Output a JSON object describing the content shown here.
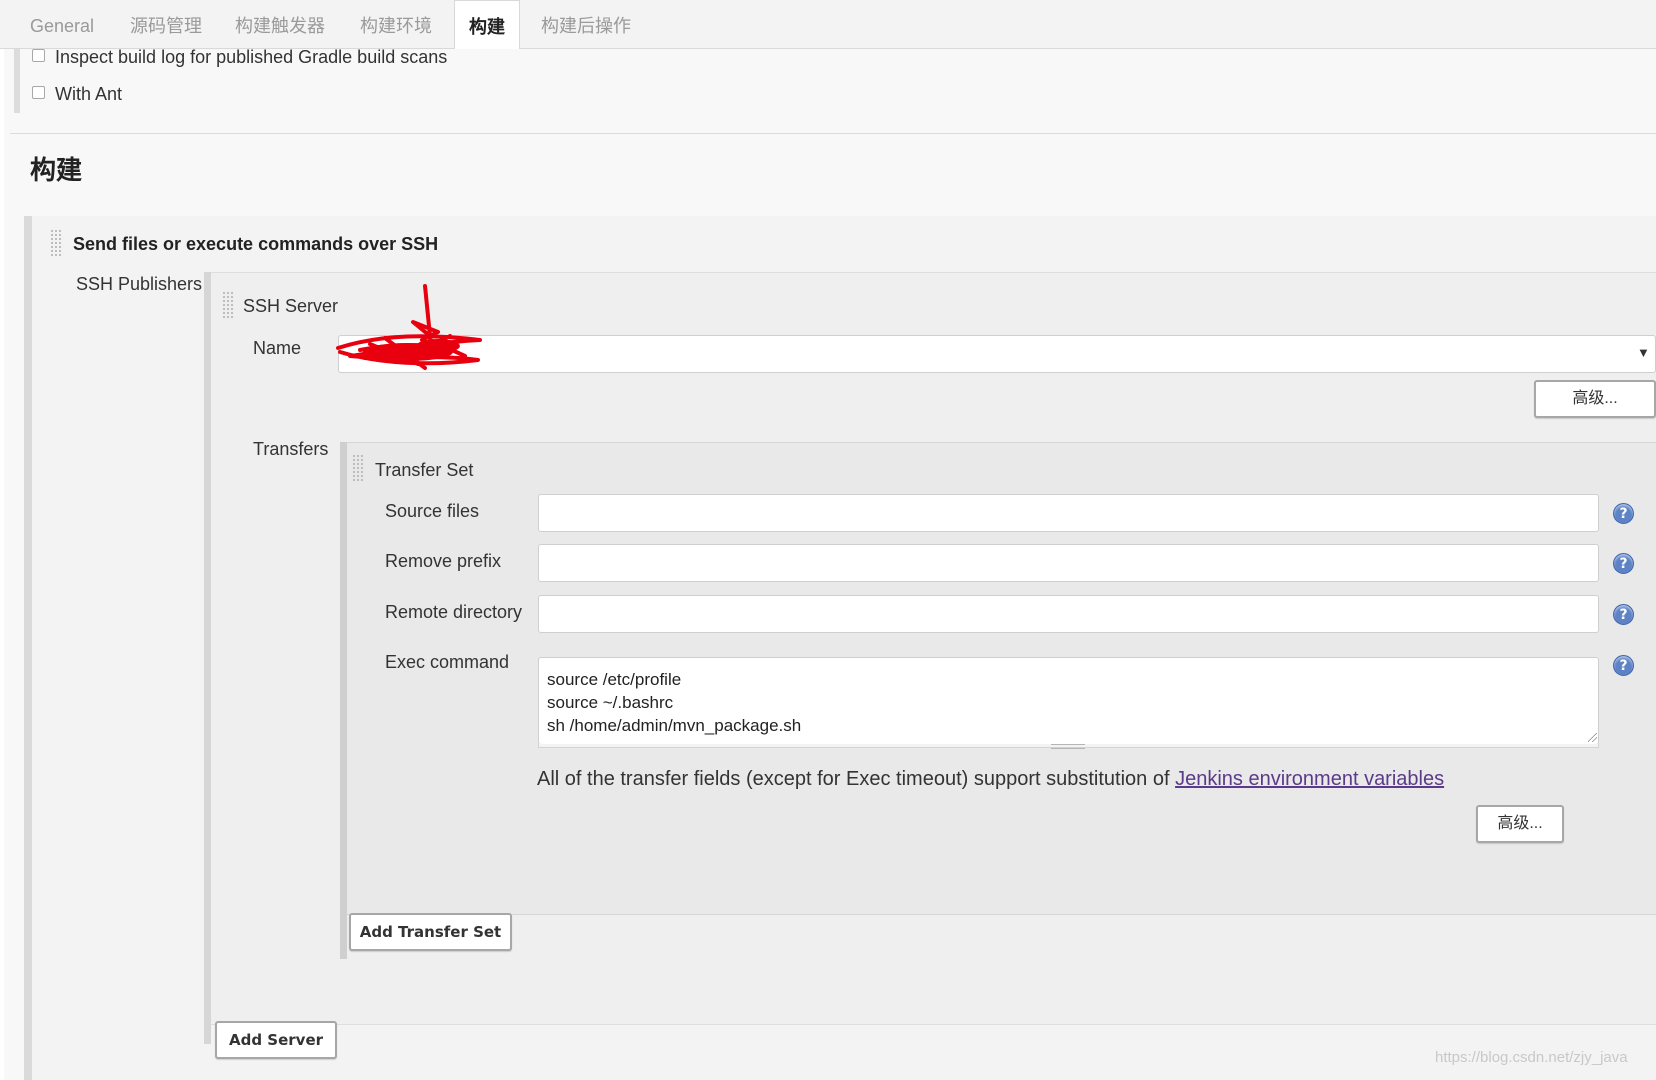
{
  "tabs": [
    {
      "label": "General"
    },
    {
      "label": "源码管理"
    },
    {
      "label": "构建触发器"
    },
    {
      "label": "构建环境"
    },
    {
      "label": "构建"
    },
    {
      "label": "构建后操作"
    }
  ],
  "env_options": [
    {
      "label": "Inspect build log for published Gradle build scans",
      "checked": false
    },
    {
      "label": "With Ant",
      "checked": false
    }
  ],
  "section": {
    "title": "构建"
  },
  "build_step": {
    "title": "Send files or execute commands over SSH",
    "publishers_label": "SSH Publishers",
    "server": {
      "title": "SSH Server",
      "name_label": "Name",
      "name_value": "",
      "advanced_label": "高级..."
    },
    "transfers_label": "Transfers",
    "transfer_set": {
      "title": "Transfer Set",
      "source_files_label": "Source files",
      "source_files_value": "",
      "remove_prefix_label": "Remove prefix",
      "remove_prefix_value": "",
      "remote_directory_label": "Remote directory",
      "remote_directory_value": "",
      "exec_command_label": "Exec command",
      "exec_command_lines": [
        "source /etc/profile",
        "source ~/.bashrc",
        "sh /home/admin/mvn_package.sh"
      ],
      "note_text": "All of the transfer fields (except for Exec timeout) support substitution of ",
      "note_link": "Jenkins environment variables",
      "advanced_label": "高级..."
    },
    "add_transfer_set_label": "Add Transfer Set",
    "add_server_label": "Add Server"
  },
  "help_icon_glyph": "?",
  "watermark": "https://blog.csdn.net/zjy_java",
  "colors": {
    "help_icon": "#5d83c6",
    "link": "#5b3a8a",
    "redaction": "#e8000f"
  }
}
